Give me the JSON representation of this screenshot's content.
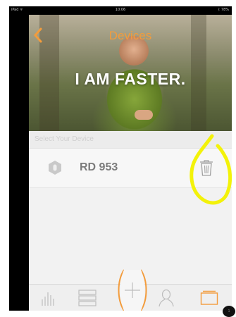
{
  "status_bar": {
    "carrier": "iPad ᯤ",
    "time": "10:06",
    "battery": "ᛒ 78%"
  },
  "header": {
    "title": "Devices",
    "back_icon": "chevron-left-icon"
  },
  "hero": {
    "tagline": "I AM FASTER."
  },
  "section": {
    "label": "Select Your Device"
  },
  "devices": [
    {
      "name": "RD 953",
      "icon": "hexagon-device-icon",
      "action_icon": "trash-icon"
    }
  ],
  "tab_bar": {
    "items": [
      {
        "name": "stats",
        "icon": "bar-chart-icon"
      },
      {
        "name": "list",
        "icon": "stack-icon"
      },
      {
        "name": "add",
        "icon": "plus-icon"
      },
      {
        "name": "profile",
        "icon": "person-icon"
      },
      {
        "name": "devices",
        "icon": "device-frame-icon",
        "active": true
      }
    ]
  },
  "colors": {
    "accent": "#f39c3c",
    "annotation": "#f3f20a",
    "hero_text": "#ffffff",
    "device_text": "#7b7b7b"
  },
  "corner_badge": "1"
}
